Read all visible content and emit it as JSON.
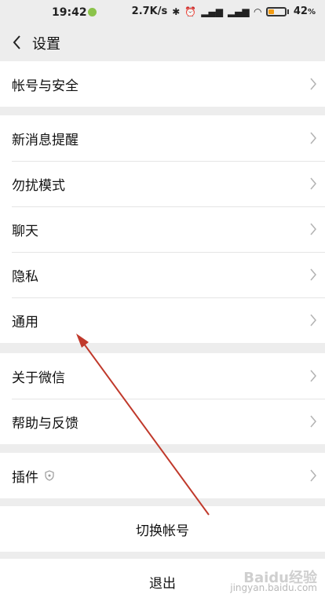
{
  "status_bar": {
    "time": "19:42",
    "network_speed": "2.7K/s",
    "battery_percent": "42",
    "battery_unit": "%",
    "battery_level": 0.42
  },
  "header": {
    "title": "设置"
  },
  "groups": [
    {
      "items": [
        {
          "label": "帐号与安全"
        }
      ]
    },
    {
      "items": [
        {
          "label": "新消息提醒"
        },
        {
          "label": "勿扰模式"
        },
        {
          "label": "聊天"
        },
        {
          "label": "隐私"
        },
        {
          "label": "通用"
        }
      ]
    },
    {
      "items": [
        {
          "label": "关于微信"
        },
        {
          "label": "帮助与反馈"
        }
      ]
    },
    {
      "items": [
        {
          "label": "插件"
        }
      ]
    }
  ],
  "actions": {
    "switch_account": "切换帐号",
    "logout": "退出"
  },
  "watermark": {
    "logo": "Baidu经验",
    "url": "jingyan.baidu.com"
  },
  "colors": {
    "background": "#ededed",
    "row_bg": "#ffffff",
    "annotation_arrow": "#c0392b"
  }
}
